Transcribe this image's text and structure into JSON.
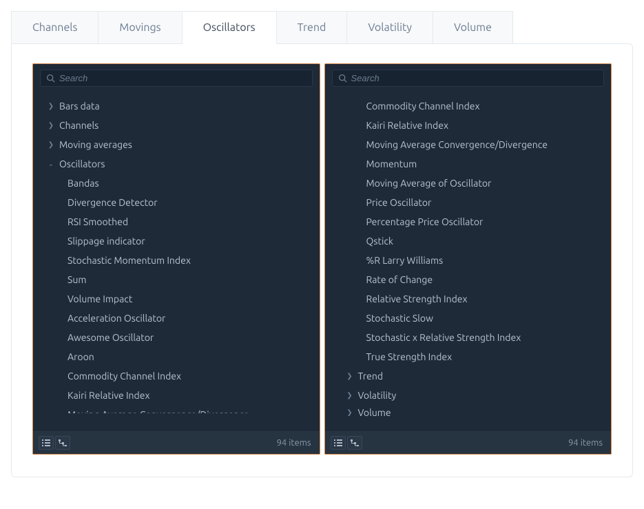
{
  "tabs": {
    "items": [
      {
        "label": "Channels",
        "active": false
      },
      {
        "label": "Movings",
        "active": false
      },
      {
        "label": "Oscillators",
        "active": true
      },
      {
        "label": "Trend",
        "active": false
      },
      {
        "label": "Volatility",
        "active": false
      },
      {
        "label": "Volume",
        "active": false
      }
    ]
  },
  "search": {
    "placeholder": "Search"
  },
  "panel_left": {
    "groups_before": [
      {
        "label": "Bars data",
        "expanded": false
      },
      {
        "label": "Channels",
        "expanded": false
      },
      {
        "label": "Moving averages",
        "expanded": false
      }
    ],
    "expanded_group": "Oscillators",
    "children": [
      "Bandas",
      "Divergence Detector",
      "RSI Smoothed",
      "Slippage indicator",
      "Stochastic Momentum Index",
      "Sum",
      "Volume Impact",
      "Acceleration Oscillator",
      "Awesome Oscillator",
      "Aroon",
      "Commodity Channel Index",
      "Kairi Relative Index"
    ],
    "cutoff": "Moving Average Convergence/Divergence",
    "footer_count": "94 items"
  },
  "panel_right": {
    "children": [
      "Commodity Channel Index",
      "Kairi Relative Index",
      "Moving Average Convergence/Divergence",
      "Momentum",
      "Moving Average of Oscillator",
      "Price Oscillator",
      "Percentage Price Oscillator",
      "Qstick",
      "%R Larry Williams",
      "Rate of Change",
      "Relative Strength Index",
      "Stochastic Slow",
      "Stochastic x Relative Strength Index",
      "True Strength Index"
    ],
    "groups_after": [
      {
        "label": "Trend",
        "expanded": false
      },
      {
        "label": "Volatility",
        "expanded": false
      },
      {
        "label": "Volume",
        "expanded": false,
        "cutoff": true
      }
    ],
    "footer_count": "94 items"
  }
}
